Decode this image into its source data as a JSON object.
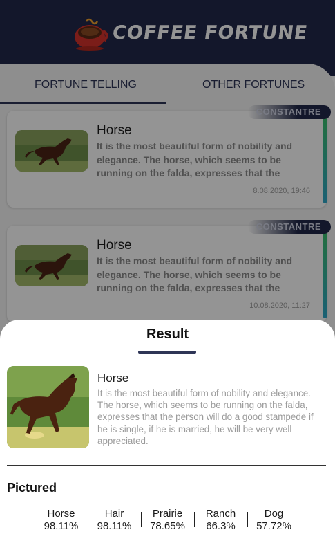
{
  "app": {
    "title": "COFFEE FORTUNE"
  },
  "tabs": [
    {
      "label": "FORTUNE TELLING",
      "active": true
    },
    {
      "label": "OTHER FORTUNES",
      "active": false
    }
  ],
  "cards": [
    {
      "badge": "CONSTANTRE",
      "title": "Horse",
      "text": "It is the most beautiful form of nobility and elegance. The horse, which seems to be running on the falda, expresses that the",
      "date": "8.08.2020, 19:46"
    },
    {
      "badge": "CONSTANTRE",
      "title": "Horse",
      "text": "It is the most beautiful form of nobility and elegance. The horse, which seems to be running on the falda, expresses that the",
      "date": "10.08.2020, 11:27"
    }
  ],
  "result": {
    "heading": "Result",
    "title": "Horse",
    "text": "It is the most beautiful form of nobility and elegance. The horse, which seems to be running on the falda, expresses that the person will do a good stampede if he is single, if he is married, he will be very well appreciated.",
    "pictured_label": "Pictured",
    "tags": [
      {
        "name": "Horse",
        "score": "98.11%"
      },
      {
        "name": "Hair",
        "score": "98.11%"
      },
      {
        "name": "Prairie",
        "score": "78.65%"
      },
      {
        "name": "Ranch",
        "score": "66.3%"
      },
      {
        "name": "Dog",
        "score": "57.72%"
      }
    ]
  },
  "colors": {
    "header": "#22294a",
    "accent": "#2e3556",
    "strip_top": "#3bbf6e",
    "strip_bottom": "#2fa6c8"
  },
  "icons": {
    "logo": "coffee-cup-icon",
    "photo": "horse-photo"
  }
}
